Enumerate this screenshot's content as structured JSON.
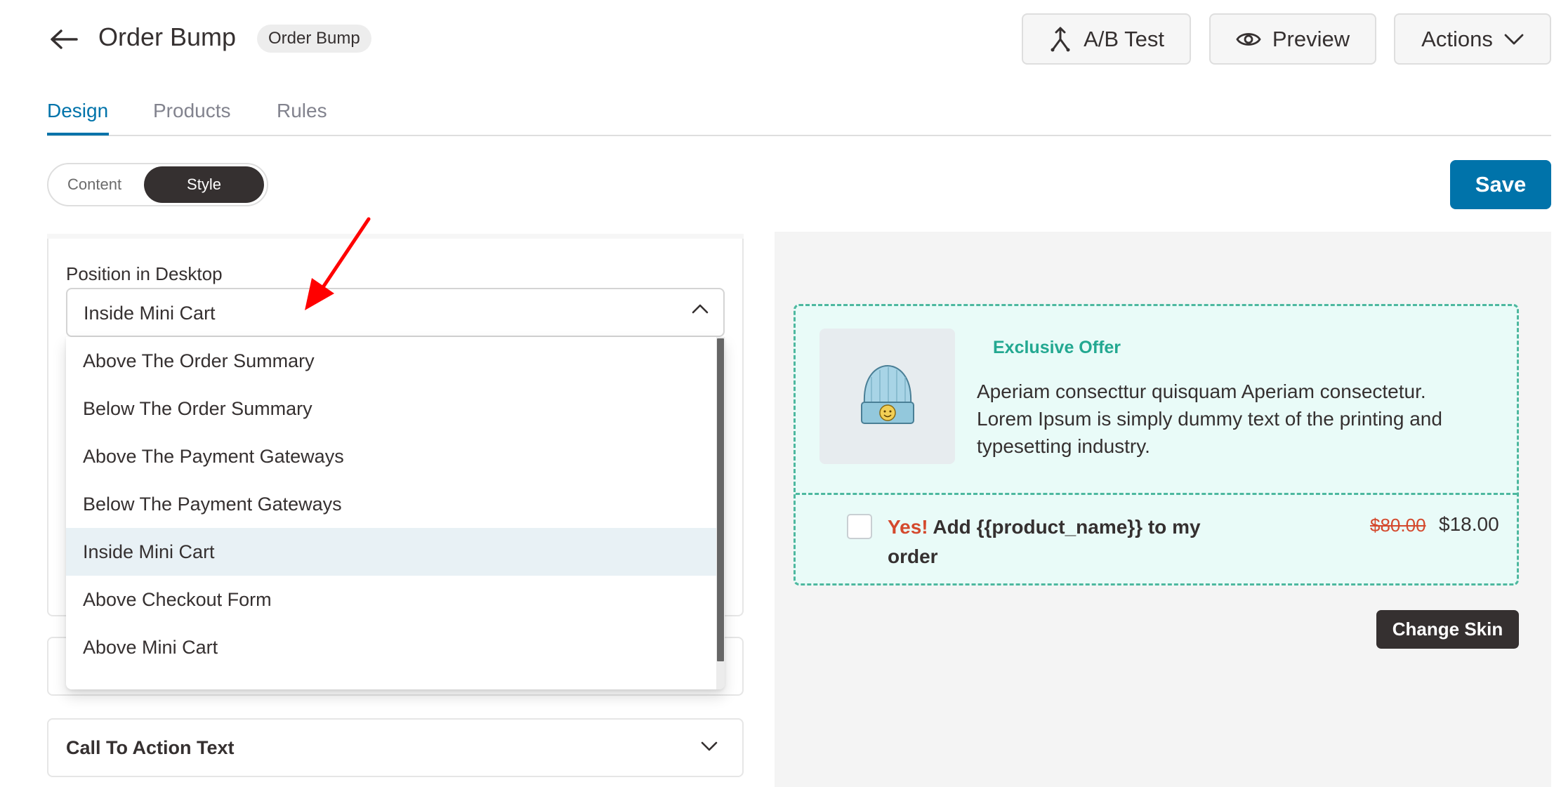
{
  "header": {
    "title": "Order Bump",
    "badge": "Order Bump",
    "ab_test_label": "A/B Test",
    "preview_label": "Preview",
    "actions_label": "Actions"
  },
  "tabs": [
    {
      "label": "Design",
      "active": true
    },
    {
      "label": "Products",
      "active": false
    },
    {
      "label": "Rules",
      "active": false
    }
  ],
  "mode_toggle": {
    "content_label": "Content",
    "style_label": "Style",
    "selected": "Style"
  },
  "save_label": "Save",
  "settings": {
    "position_label": "Position in Desktop",
    "position_value": "Inside Mini Cart",
    "position_options": [
      "Above The Order Summary",
      "Below The Order Summary",
      "Above The Payment Gateways",
      "Below The Payment Gateways",
      "Inside Mini Cart",
      "Above Checkout Form",
      "Above Mini Cart"
    ],
    "cta_section_label": "Call To Action Text"
  },
  "preview": {
    "offer_title": "Exclusive Offer",
    "offer_description": "Aperiam consecttur quisquam Aperiam consectetur. Lorem Ipsum is simply dummy text of the printing and typesetting industry.",
    "yes_word": "Yes!",
    "add_text": "Add {{product_name}} to my order",
    "old_price": "$80.00",
    "new_price": "$18.00",
    "change_skin_label": "Change Skin"
  },
  "colors": {
    "primary": "#0073aa",
    "dark": "#353030",
    "bump_bg": "#e9fbf8",
    "bump_border": "#4db89f",
    "offer_title": "#23a891",
    "yes_red": "#d4492d",
    "annotation_arrow": "#ff0000"
  },
  "icons": {
    "back": "arrow-left-icon",
    "ab_test": "split-arrows-icon",
    "preview": "eye-icon",
    "actions": "chevron-down-icon",
    "select": "chevron-up-icon",
    "cta": "chevron-down-icon",
    "product": "beanie-hat-icon"
  }
}
